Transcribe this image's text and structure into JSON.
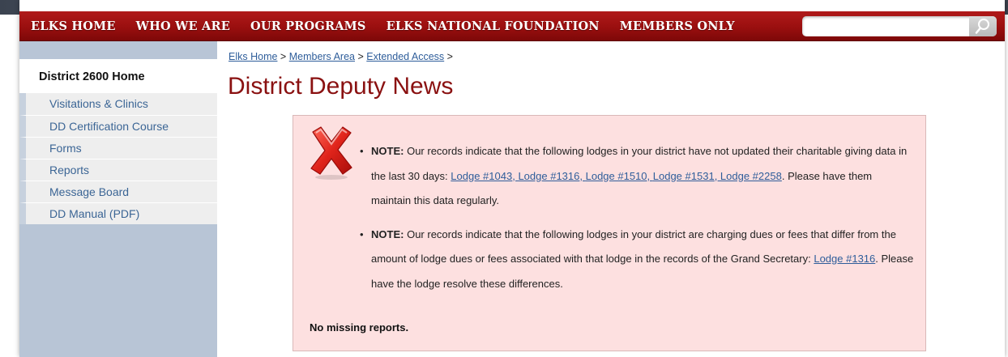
{
  "nav": {
    "items": [
      "ELKS HOME",
      "WHO WE ARE",
      "OUR PROGRAMS",
      "ELKS NATIONAL FOUNDATION",
      "MEMBERS ONLY"
    ],
    "search_value": "",
    "search_icon": "search-icon"
  },
  "sidebar": {
    "home_label": "District 2600 Home",
    "items": [
      {
        "label": "Visitations & Clinics"
      },
      {
        "label": "DD Certification Course"
      },
      {
        "label": "Forms"
      },
      {
        "label": "Reports"
      },
      {
        "label": "Message Board"
      },
      {
        "label": "DD Manual (PDF)"
      }
    ]
  },
  "breadcrumb": {
    "items": [
      "Elks Home",
      "Members Area",
      "Extended Access"
    ],
    "separator": ">"
  },
  "page_title": "District Deputy News",
  "notice": {
    "icon": "error-x-icon",
    "notes": [
      {
        "prefix": "NOTE:",
        "text_before": "Our records indicate that the following lodges in your district have not updated their charitable giving data in the last 30 days:",
        "links": [
          "Lodge #1043",
          "Lodge #1316",
          "Lodge #1510",
          "Lodge #1531",
          "Lodge #2258"
        ],
        "text_after": ". Please have them maintain this data regularly."
      },
      {
        "prefix": "NOTE:",
        "text_before": "Our records indicate that the following lodges in your district are charging dues or fees that differ from the amount of lodge dues or fees associated with that lodge in the records of the Grand Secretary:",
        "links": [
          "Lodge #1316"
        ],
        "text_after": ". Please have the lodge resolve these differences."
      }
    ],
    "footer": "No missing reports."
  },
  "colors": {
    "nav_red": "#9a0f0f",
    "title_red": "#8a1111",
    "link_blue": "#2e5d9a",
    "notice_bg": "#fde0e0",
    "sidebar_bg": "#b8c5d6"
  }
}
